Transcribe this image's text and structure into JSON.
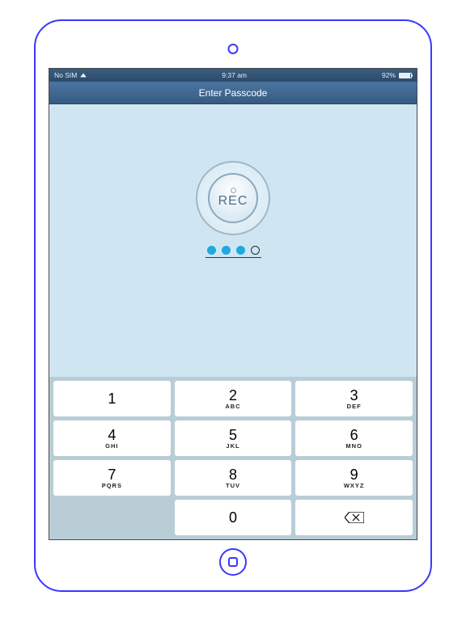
{
  "status": {
    "carrier": "No SIM",
    "time": "9:37 am",
    "battery_pct": "92%"
  },
  "nav": {
    "title": "Enter Passcode"
  },
  "rec": {
    "label": "REC"
  },
  "pin": {
    "dots": [
      true,
      true,
      true,
      false
    ]
  },
  "keypad": [
    {
      "digit": "1",
      "letters": ""
    },
    {
      "digit": "2",
      "letters": "ABC"
    },
    {
      "digit": "3",
      "letters": "DEF"
    },
    {
      "digit": "4",
      "letters": "GHI"
    },
    {
      "digit": "5",
      "letters": "JKL"
    },
    {
      "digit": "6",
      "letters": "MNO"
    },
    {
      "digit": "7",
      "letters": "PQRS"
    },
    {
      "digit": "8",
      "letters": "TUV"
    },
    {
      "digit": "9",
      "letters": "WXYZ"
    },
    {
      "digit": "",
      "letters": "",
      "blank": true
    },
    {
      "digit": "0",
      "letters": ""
    },
    {
      "digit": "",
      "letters": "",
      "backspace": true
    }
  ]
}
